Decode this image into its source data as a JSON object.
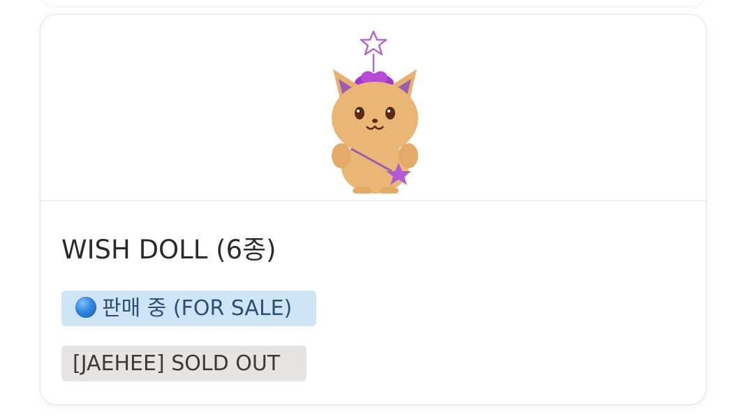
{
  "product": {
    "title": "WISH DOLL (6종)",
    "image_alt": "plush doll keychain",
    "tags": [
      {
        "icon": "blue-circle-icon",
        "label": "판매 중 (FOR SALE)",
        "bg": "#cfe4f5",
        "color": "#2c4f78"
      },
      {
        "label": "[JAEHEE] SOLD OUT",
        "bg": "#e5e4e2",
        "color": "#3a3a3a"
      }
    ]
  }
}
